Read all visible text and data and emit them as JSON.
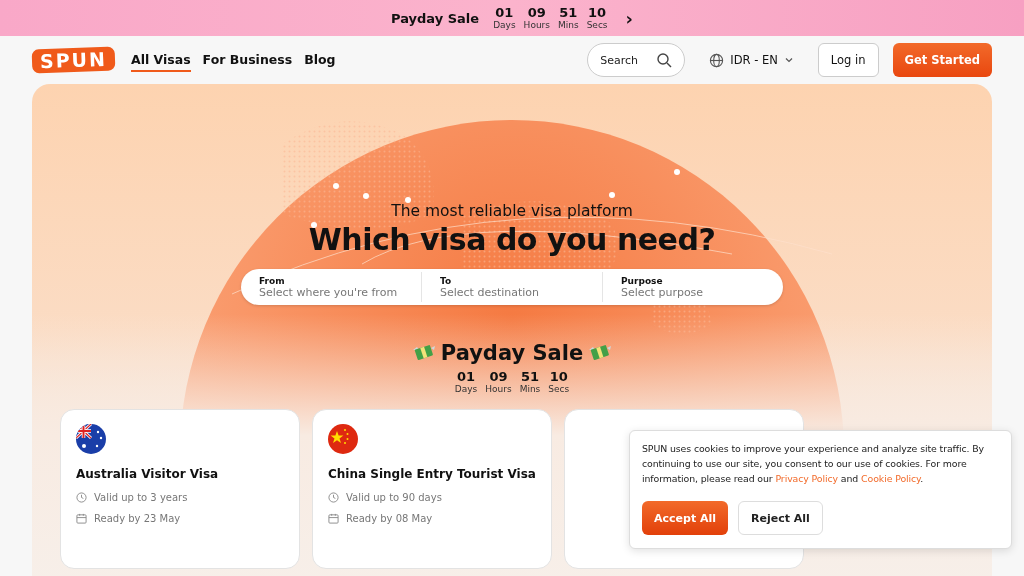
{
  "promo_bar": {
    "title": "Payday Sale",
    "countdown": [
      {
        "value": "01",
        "unit": "Days"
      },
      {
        "value": "09",
        "unit": "Hours"
      },
      {
        "value": "51",
        "unit": "Mins"
      },
      {
        "value": "10",
        "unit": "Secs"
      }
    ],
    "arrow": "›"
  },
  "nav": {
    "logo": "SPUN",
    "links": [
      {
        "label": "All Visas",
        "selected": true
      },
      {
        "label": "For Business",
        "selected": false
      },
      {
        "label": "Blog",
        "selected": false
      }
    ],
    "search": {
      "placeholder": "Search"
    },
    "locale": "IDR - EN",
    "login": "Log in",
    "cta": "Get Started"
  },
  "hero": {
    "subtitle": "The most reliable visa platform",
    "title": "Which visa do you need?",
    "search_fields": [
      {
        "label": "From",
        "placeholder": "Select where you're from"
      },
      {
        "label": "To",
        "placeholder": "Select destination"
      },
      {
        "label": "Purpose",
        "placeholder": "Select purpose"
      }
    ],
    "sale": {
      "title": "Payday Sale",
      "countdown": [
        {
          "value": "01",
          "unit": "Days"
        },
        {
          "value": "09",
          "unit": "Hours"
        },
        {
          "value": "51",
          "unit": "Mins"
        },
        {
          "value": "10",
          "unit": "Secs"
        }
      ]
    }
  },
  "visa_cards": [
    {
      "kind": "australia",
      "title": "Australia Visitor Visa",
      "validity": "Valid up to 3 years",
      "ready": "Ready by 23 May"
    },
    {
      "kind": "china",
      "title": "China Single Entry Tourist Visa",
      "validity": "Valid up to 90 days",
      "ready": "Ready by 08 May"
    },
    {
      "kind": "blank"
    }
  ],
  "cookie_banner": {
    "text_before": "SPUN uses cookies to improve your experience and analyze site traffic. By continuing to use our site, you consent to our use of cookies. For more information, please read our ",
    "link_1": "Privacy Policy",
    "text_between": " and ",
    "link_2": "Cookie Policy",
    "text_after": ".",
    "accept": "Accept All",
    "reject": "Reject All"
  }
}
